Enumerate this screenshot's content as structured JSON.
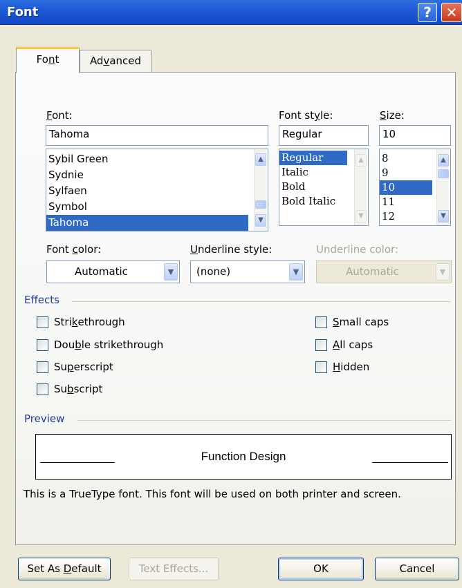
{
  "window": {
    "title": "Font",
    "help_label": "?",
    "close_label": "✕"
  },
  "tabs": [
    {
      "label_pre": "Fo",
      "label_u": "n",
      "label_post": "t"
    },
    {
      "label_pre": "Ad",
      "label_u": "v",
      "label_post": "anced"
    }
  ],
  "font": {
    "label_u": "F",
    "label_post": "ont:",
    "value": "Tahoma",
    "list": [
      "Sybil Green",
      "Sydnie",
      "Sylfaen",
      "Symbol",
      "Tahoma"
    ],
    "selected": "Tahoma"
  },
  "font_style": {
    "label_pre": "Font st",
    "label_u": "y",
    "label_post": "le:",
    "value": "Regular",
    "list": [
      "Regular",
      "Italic",
      "Bold",
      "Bold Italic"
    ],
    "selected": "Regular"
  },
  "size": {
    "label_u": "S",
    "label_post": "ize:",
    "value": "10",
    "list": [
      "8",
      "9",
      "10",
      "11",
      "12"
    ],
    "selected": "10"
  },
  "font_color": {
    "label_pre": "Font ",
    "label_u": "c",
    "label_post": "olor:",
    "value": "Automatic"
  },
  "underline_style": {
    "label_u": "U",
    "label_post": "nderline style:",
    "value": "(none)"
  },
  "underline_color": {
    "label": "Underline color:",
    "value": "Automatic"
  },
  "effects": {
    "title": "Effects",
    "left": [
      {
        "pre": "Stri",
        "u": "k",
        "post": "ethrough"
      },
      {
        "pre": "Dou",
        "u": "b",
        "post": "le strikethrough"
      },
      {
        "pre": "Su",
        "u": "p",
        "post": "erscript"
      },
      {
        "pre": "Su",
        "u": "b",
        "post": "script"
      }
    ],
    "right": [
      {
        "pre": "",
        "u": "S",
        "post": "mall caps"
      },
      {
        "pre": "",
        "u": "A",
        "post": "ll caps"
      },
      {
        "pre": "",
        "u": "H",
        "post": "idden"
      }
    ]
  },
  "preview": {
    "title": "Preview",
    "text": "Function Design",
    "note": "This is a TrueType font. This font will be used on both printer and screen."
  },
  "buttons": {
    "set_default_pre": "Set As ",
    "set_default_u": "D",
    "set_default_post": "efault",
    "text_effects": "Text Effects...",
    "ok": "OK",
    "cancel": "Cancel"
  }
}
